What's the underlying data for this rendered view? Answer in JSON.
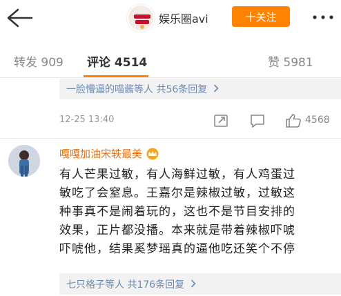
{
  "header": {
    "account_name": "娱乐圈avi",
    "follow_label": "十关注"
  },
  "tabs": {
    "repost": "转发 909",
    "comments": "评论 4514",
    "likes": "赞 5981"
  },
  "prev_comment": {
    "reply_prefix": "一脸懵逼的喵酱等人",
    "reply_count": "共56条回复",
    "timestamp": "12-25 13:40",
    "like_count": "4568"
  },
  "comment": {
    "username": "嘎嘎加油宋轶最美",
    "text": "有人芒果过敏，有人海鲜过敏，有人鸡蛋过\n敏吃了会窒息。王嘉尔是辣椒过敏，过敏这\n种事真不是闹着玩的，这也不是节目安排的\n效果，正片都没播。本来就是带着辣椒吓唬\n吓唬他，结果奚梦瑶真的逼他吃还笑个不停",
    "reply_prefix": "七只格子等人",
    "reply_count": "共176条回复"
  },
  "colors": {
    "accent": "#ff8200",
    "link": "#6a8ab0",
    "username": "#e86f0c"
  }
}
